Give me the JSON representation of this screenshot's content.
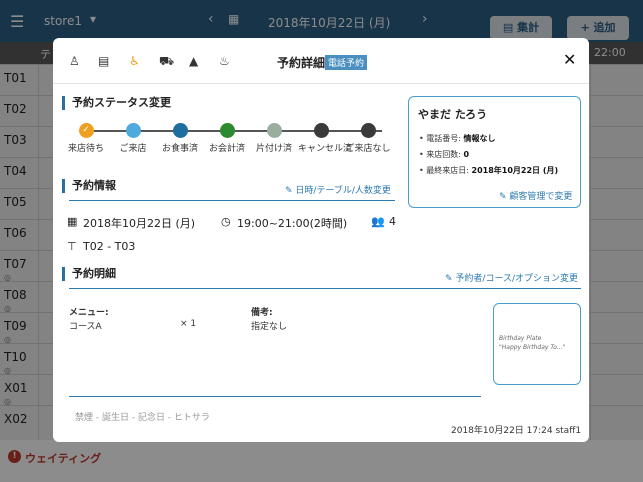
{
  "app": {
    "store_name": "store1",
    "date": "2018年10月22日 (月)",
    "summary_label": "集計",
    "add_label": "追加",
    "col_head_left": "テ",
    "col_head_right": "22:00",
    "tables": [
      {
        "label": "T01",
        "sub": ""
      },
      {
        "label": "T02",
        "sub": ""
      },
      {
        "label": "T03",
        "sub": ""
      },
      {
        "label": "T04",
        "sub": ""
      },
      {
        "label": "T05",
        "sub": ""
      },
      {
        "label": "T06",
        "sub": ""
      },
      {
        "label": "T07",
        "sub": "◎"
      },
      {
        "label": "T08",
        "sub": "◎"
      },
      {
        "label": "T09",
        "sub": "◎"
      },
      {
        "label": "T10",
        "sub": "◎"
      },
      {
        "label": "X01",
        "sub": "◎"
      },
      {
        "label": "X02",
        "sub": ""
      }
    ],
    "waiting_label": "ウェイティング"
  },
  "modal": {
    "title": "予約詳細",
    "badge": "電話予約",
    "header_icons": [
      "person-icon",
      "document-icon",
      "wheelchair-icon",
      "stroller-icon",
      "warning-icon",
      "cake-icon"
    ],
    "status": {
      "title": "予約ステータス変更",
      "steps": [
        {
          "label": "来店待ち",
          "color": "#f0a020",
          "checked": true
        },
        {
          "label": "ご来店",
          "color": "#4ea9dd",
          "checked": false
        },
        {
          "label": "お食事済",
          "color": "#1e6fa0",
          "checked": false
        },
        {
          "label": "お会計済",
          "color": "#2e8a2e",
          "checked": false
        },
        {
          "label": "片付け済",
          "color": "#9aaea0",
          "checked": false
        },
        {
          "label": "キャンセル済",
          "color": "#3a3a3a",
          "checked": false
        },
        {
          "label": "ご来店なし",
          "color": "#3a3a3a",
          "checked": false
        }
      ]
    },
    "customer": {
      "name": "やまだ たろう",
      "phone_label": "電話番号:",
      "phone_value": "情報なし",
      "visits_label": "来店回数:",
      "visits_value": "0",
      "last_visit_label": "最終来店日:",
      "last_visit_value": "2018年10月22日 (月)",
      "manage_link": "顧客管理で変更"
    },
    "reservation": {
      "title": "予約情報",
      "edit_link": "日時/テーブル/人数変更",
      "date": "2018年10月22日 (月)",
      "time": "19:00~21:00(2時間)",
      "people": "4",
      "tables": "T02 - T03"
    },
    "details": {
      "title": "予約明細",
      "edit_link": "予約者/コース/オプション変更",
      "menu_label": "メニュー:",
      "menu_item": "コースA",
      "menu_qty": "× 1",
      "note_label": "備考:",
      "note_value": "指定なし",
      "tags": "禁煙 - 誕生日 - 記念日 - ヒトサラ",
      "stamp": "2018年10月22日 17:24 staff1"
    }
  }
}
